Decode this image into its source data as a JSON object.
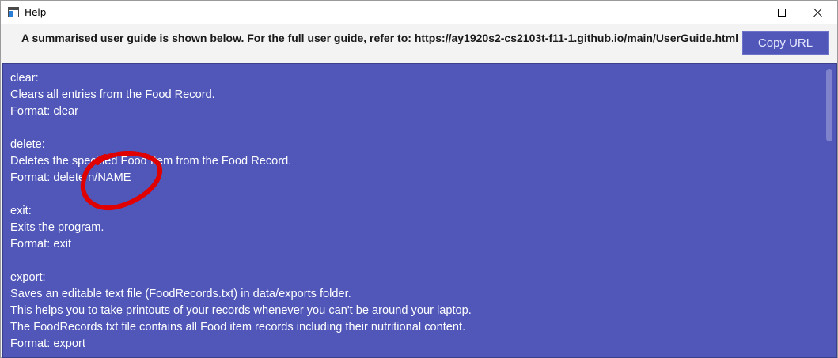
{
  "window": {
    "title": "Help"
  },
  "url_bar": {
    "message": "A summarised user guide is shown below. For the full user guide, refer to: https://ay1920s2-cs2103t-f11-1.github.io/main/UserGuide.html",
    "copy_button_label": "Copy URL"
  },
  "guide": {
    "lines": [
      "clear:",
      "Clears all entries from the Food Record.",
      "Format: clear",
      "",
      "delete:",
      "Deletes the specified Food Item from the Food Record.",
      "Format: delete n/NAME",
      "",
      "exit:",
      "Exits the program.",
      "Format: exit",
      "",
      "export:",
      "Saves an editable text file (FoodRecords.txt) in data/exports folder.",
      "This helps you to take printouts of your records whenever you can't be around your laptop.",
      "The FoodRecords.txt file contains all Food item records including their nutritional content.",
      "Format: export"
    ]
  },
  "colors": {
    "content_background": "#5057b8",
    "annotation_circle": "#e00000"
  },
  "icons": {
    "app": "window-app-icon",
    "minimize": "minimize-icon",
    "maximize": "maximize-icon",
    "close": "close-icon"
  }
}
